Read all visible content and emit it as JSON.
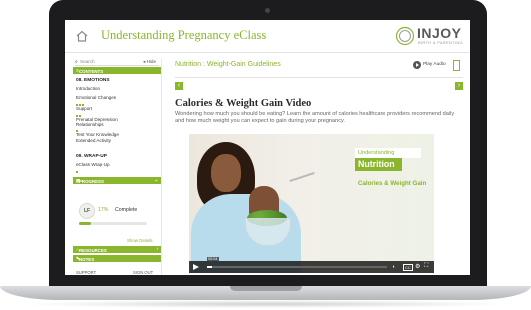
{
  "header": {
    "title": "Understanding Pregnancy eClass",
    "logo_text": "INJOY",
    "logo_sub": "BIRTH & PARENTING"
  },
  "sidebar": {
    "search_placeholder": "Search",
    "hide_label": "Hide",
    "contents_label": "CONTENTS",
    "section1_title": "08. EMOTIONS",
    "items": [
      {
        "label": "Introduction"
      },
      {
        "label": "Emotional Changes"
      },
      {
        "label": "Support"
      },
      {
        "label": "Prenatal Depression"
      },
      {
        "label": "Relationships"
      },
      {
        "label": "Test Your Knowledge"
      },
      {
        "label": "Extended Activity"
      }
    ],
    "section2_title": "09. WRAP-UP",
    "wrap_items": [
      {
        "label": "eClass Wrap-Up"
      }
    ],
    "progress_label": "PROGRESS 17%",
    "progress": {
      "initials": "LF",
      "percent": "17%",
      "status": "Complete",
      "fraction": 0.17
    },
    "show_details": "Show Details",
    "resources_label": "RESOURCES & TOOLS",
    "notes_label": "NOTES",
    "support_label": "SUPPORT",
    "signout_label": "SIGN OUT"
  },
  "main": {
    "breadcrumb": "Nutrition : Weight-Gain Guidelines",
    "play_audio": "Play Audio",
    "heading": "Calories & Weight Gain Video",
    "description": "Wondering how much you should be eating? Learn the amount of calories healthcare providers recommend daily and how much weight you can expect to gain during your pregnancy."
  },
  "video": {
    "card_top": "Understanding",
    "card_main": "Nutrition",
    "card_sub": "Calories & Weight Gain",
    "time": "00:04",
    "progress": 0.03,
    "brand_color": "#8ab62e"
  }
}
